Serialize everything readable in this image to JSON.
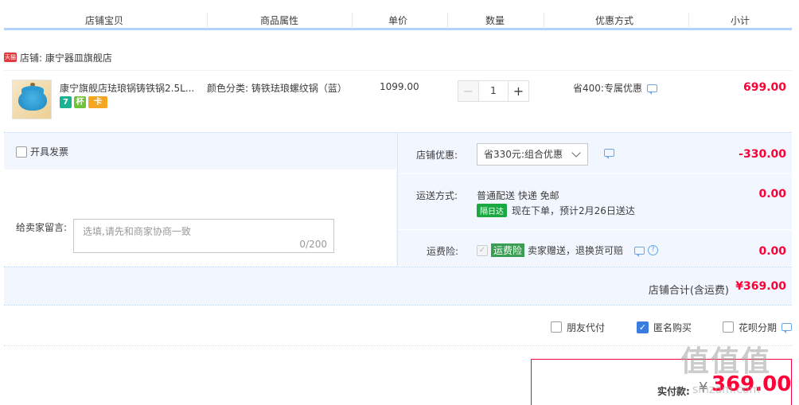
{
  "header": {
    "columns": [
      "店铺宝贝",
      "商品属性",
      "单价",
      "数量",
      "优惠方式",
      "小计"
    ]
  },
  "shop": {
    "badge": "天猫",
    "label": "店铺: 康宁器皿旗舰店"
  },
  "item": {
    "title": "康宁旗舰店珐琅锅铸铁锅2.5L...",
    "badges": [
      "7",
      "杯",
      "卡"
    ],
    "attr": "颜色分类: 铸铁珐琅螺纹锅（蓝）",
    "price": "1099.00",
    "quantity": "1",
    "minus": "−",
    "plus": "+",
    "promo": "省400:专属优惠",
    "subtotal": "699.00"
  },
  "invoice": {
    "label": "开具发票"
  },
  "message": {
    "label": "给卖家留言:",
    "placeholder": "选填,请先和商家协商一致",
    "count": "0/200"
  },
  "shop_discount": {
    "label": "店铺优惠:",
    "selected": "省330元:组合优惠",
    "amount": "-330.00"
  },
  "shipping": {
    "label": "运送方式:",
    "method": "普通配送 快递 免邮",
    "tag": "隔日达",
    "eta": "现在下单，预计2月26日送达",
    "amount": "0.00"
  },
  "insurance": {
    "label": "运费险:",
    "tag": "运费险",
    "desc": "卖家赠送，退换货可赔",
    "help": "?",
    "amount": "0.00"
  },
  "shop_total": {
    "label": "店铺合计(含运费)",
    "amount": "¥369.00"
  },
  "options": {
    "friend_pay": "朋友代付",
    "anonymous": "匿名购买",
    "huabei": "花呗分期"
  },
  "pay": {
    "label": "实付款:",
    "yen": "¥",
    "amount": "369.00"
  },
  "watermark": {
    "text": "值值值",
    "url": "smzdm.com"
  },
  "colors": {
    "accent": "#ff0036",
    "header_line": "#b2d1ff",
    "panel_bg": "#f2f7ff",
    "checkbox_blue": "#3a7de0"
  }
}
